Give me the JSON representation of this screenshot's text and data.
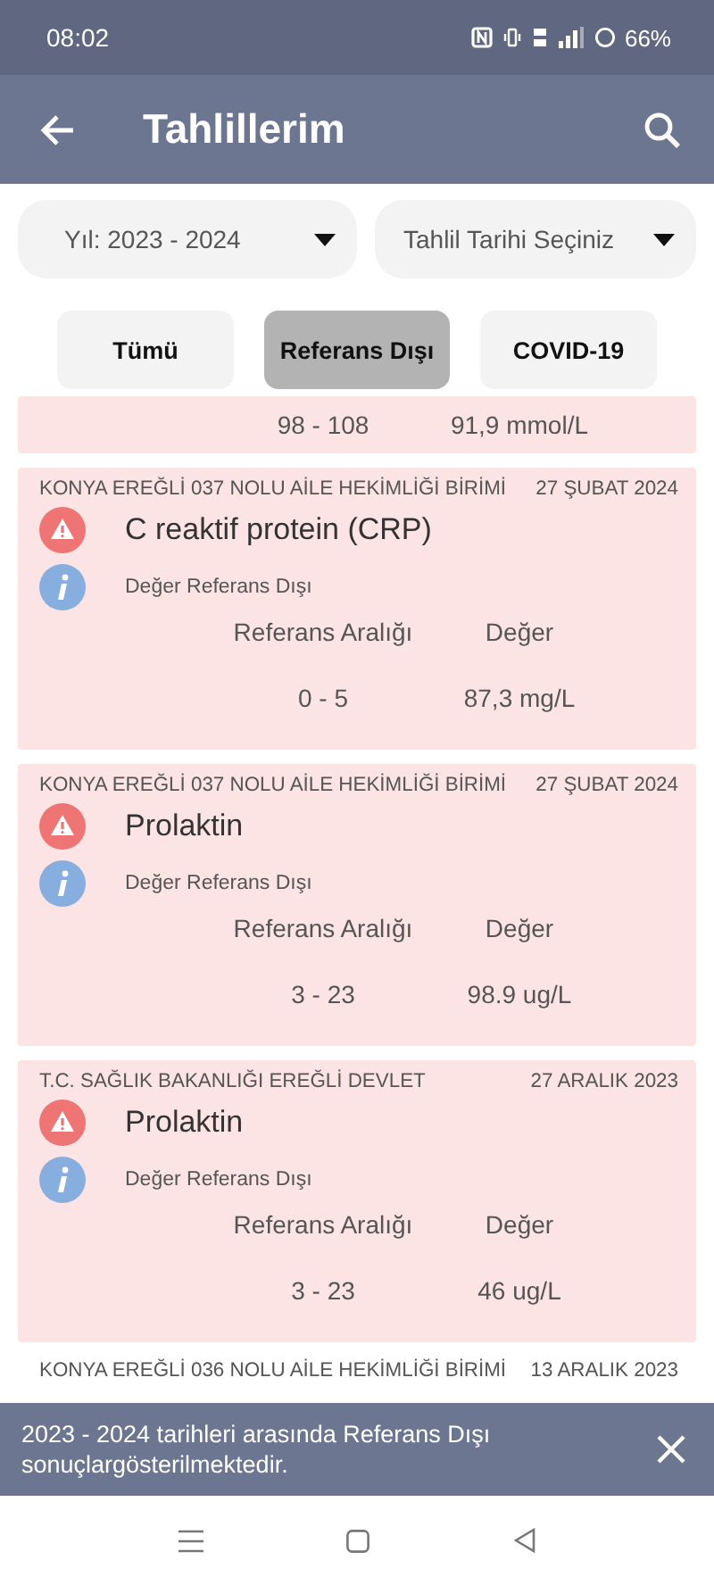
{
  "status_bar": {
    "time": "08:02",
    "battery": "66%"
  },
  "app_bar": {
    "title": "Tahlillerim"
  },
  "filters": [
    {
      "value": "Yıl: 2023 - 2024"
    },
    {
      "value": "Tahlil Tarihi Seçiniz"
    }
  ],
  "tabs": [
    {
      "label": "Tümü",
      "selected": false
    },
    {
      "label": "Referans Dışı",
      "selected": true
    },
    {
      "label": "COVID-19",
      "selected": false
    }
  ],
  "results": [
    {
      "kind": "partial",
      "range": "98 - 108",
      "value": "91,9 mmol/L"
    },
    {
      "kind": "full",
      "institution": "KONYA EREĞLİ 037 NOLU AİLE HEKİMLİĞİ BİRİMİ",
      "date": "27 ŞUBAT 2024",
      "test": "C reaktif protein (CRP)",
      "status": "Değer Referans Dışı",
      "range_label": "Referans Aralığı",
      "value_label": "Değer",
      "range": "0 - 5",
      "value": "87,3 mg/L"
    },
    {
      "kind": "full",
      "institution": "KONYA EREĞLİ 037 NOLU AİLE HEKİMLİĞİ BİRİMİ",
      "date": "27 ŞUBAT 2024",
      "test": "Prolaktin",
      "status": "Değer Referans Dışı",
      "range_label": "Referans Aralığı",
      "value_label": "Değer",
      "range": "3 - 23",
      "value": "98.9 ug/L"
    },
    {
      "kind": "full",
      "institution": "T.C. SAĞLIK BAKANLIĞI EREĞLİ DEVLET",
      "date": "27 ARALIK 2023",
      "test": "Prolaktin",
      "status": "Değer Referans Dışı",
      "range_label": "Referans Aralığı",
      "value_label": "Değer",
      "range": "3 - 23",
      "value": "46 ug/L"
    },
    {
      "kind": "header",
      "institution": "KONYA EREĞLİ 036 NOLU AİLE HEKİMLİĞİ BİRİMİ",
      "date": "13 ARALIK 2023"
    }
  ],
  "snackbar": {
    "message": "2023 - 2024 tarihleri arasında Referans Dışı sonuçlargösterilmektedir."
  }
}
